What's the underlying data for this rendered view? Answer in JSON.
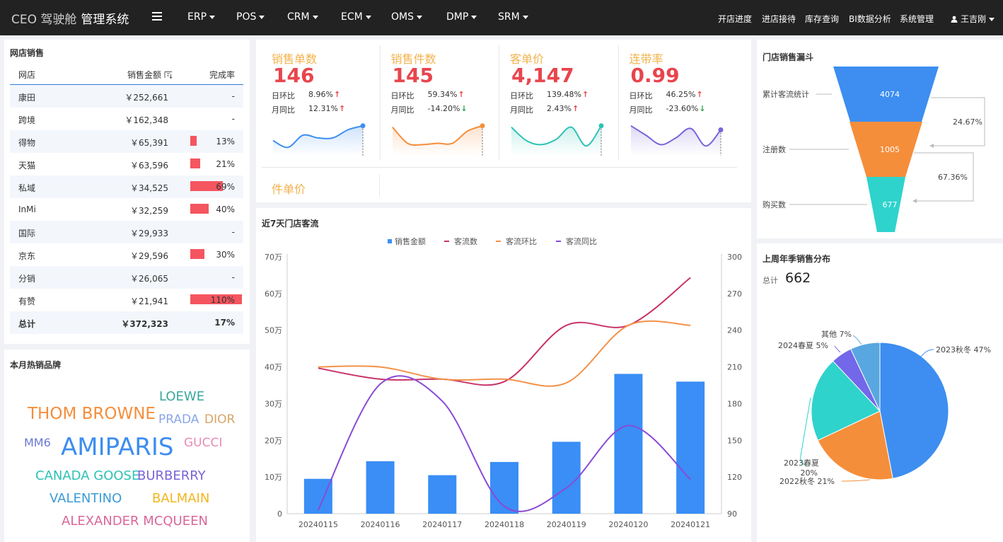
{
  "nav": {
    "brand_prefix": "CEO 驾驶舱",
    "brand_suffix": "管理系统",
    "menus": [
      "ERP",
      "POS",
      "CRM",
      "ECM",
      "OMS",
      "DMP",
      "SRM"
    ],
    "links": [
      "开店进度",
      "进店接待",
      "库存查询",
      "BI数据分析",
      "系统管理"
    ],
    "user": "王吉刚"
  },
  "store_sales": {
    "title": "网店销售",
    "columns": [
      "网店",
      "销售金额",
      "完成率"
    ],
    "rows": [
      {
        "name": "康田",
        "amount": "￥252,661",
        "rate": "-",
        "pct": null
      },
      {
        "name": "跨境",
        "amount": "￥162,348",
        "rate": "-",
        "pct": null
      },
      {
        "name": "得物",
        "amount": "￥65,391",
        "rate": "13%",
        "pct": 0.13
      },
      {
        "name": "天猫",
        "amount": "￥63,596",
        "rate": "21%",
        "pct": 0.21
      },
      {
        "name": "私域",
        "amount": "￥34,525",
        "rate": "69%",
        "pct": 0.69
      },
      {
        "name": "InMi",
        "amount": "￥32,259",
        "rate": "40%",
        "pct": 0.4
      },
      {
        "name": "国际",
        "amount": "￥29,933",
        "rate": "-",
        "pct": null
      },
      {
        "name": "京东",
        "amount": "￥29,596",
        "rate": "30%",
        "pct": 0.3
      },
      {
        "name": "分销",
        "amount": "￥26,065",
        "rate": "-",
        "pct": null
      },
      {
        "name": "有赞",
        "amount": "￥21,941",
        "rate": "110%",
        "pct": 1.1
      }
    ],
    "total": {
      "name": "总计",
      "amount": "￥372,323",
      "rate": "17%"
    }
  },
  "hot_brands": {
    "title": "本月热销品牌",
    "words": [
      {
        "text": "LOEWE",
        "color": "#3aa79a"
      },
      {
        "text": "THOM BROWNE",
        "color": "#f58e3b"
      },
      {
        "text": "PRADA",
        "color": "#8aa6e8"
      },
      {
        "text": "DIOR",
        "color": "#d8a465"
      },
      {
        "text": "MM6",
        "color": "#6b78d6"
      },
      {
        "text": "AMIPARIS",
        "color": "#3d8ef0"
      },
      {
        "text": "GUCCI",
        "color": "#e68cb4"
      },
      {
        "text": "CANADA GOOSE",
        "color": "#2ec2b6"
      },
      {
        "text": "BURBERRY",
        "color": "#7b63d9"
      },
      {
        "text": "VALENTINO",
        "color": "#3b9bd6"
      },
      {
        "text": "BALMAIN",
        "color": "#f2b51e"
      },
      {
        "text": "ALEXANDER MCQUEEN",
        "color": "#d9679a"
      }
    ]
  },
  "kpis": [
    {
      "label": "销售单数",
      "value": "146",
      "dod_label": "日环比",
      "dod": "8.96%",
      "dod_dir": "up",
      "mom_label": "月同比",
      "mom": "12.31%",
      "mom_dir": "up",
      "color": "#3d8ef0",
      "spark": [
        0.35,
        0.1,
        0.55,
        0.45,
        0.45,
        0.75,
        0.9
      ]
    },
    {
      "label": "销售件数",
      "value": "145",
      "dod_label": "日环比",
      "dod": "59.34%",
      "dod_dir": "up",
      "mom_label": "月同比",
      "mom": "-14.20%",
      "mom_dir": "down",
      "color": "#f58e3b",
      "spark": [
        0.85,
        0.25,
        0.2,
        0.25,
        0.25,
        0.7,
        0.9
      ]
    },
    {
      "label": "客单价",
      "value": "4,147",
      "dod_label": "日环比",
      "dod": "139.48%",
      "dod_dir": "up",
      "mom_label": "月同比",
      "mom": "2.43%",
      "mom_dir": "up",
      "color": "#2ec2b6",
      "spark": [
        0.85,
        0.35,
        0.2,
        0.4,
        0.85,
        0.15,
        0.9
      ]
    },
    {
      "label": "连带率",
      "value": "0.99",
      "dod_label": "日环比",
      "dod": "46.25%",
      "dod_dir": "up",
      "mom_label": "月同比",
      "mom": "-23.60%",
      "mom_dir": "down",
      "color": "#7b63d9",
      "spark": [
        0.9,
        0.55,
        0.2,
        0.45,
        0.8,
        0.15,
        0.75
      ]
    }
  ],
  "kpi_extra": {
    "label": "件单价"
  },
  "traffic": {
    "title": "近7天门店客流",
    "legend": [
      "销售金额",
      "客流数",
      "客流环比",
      "客流同比"
    ],
    "colors": {
      "bar": "#3a8ef6",
      "flow": "#c8326a",
      "mom": "#f29249",
      "yoy": "#8a4ad6"
    },
    "left_ticks": [
      "0",
      "10万",
      "20万",
      "30万",
      "40万",
      "50万",
      "60万",
      "70万"
    ],
    "right_ticks": [
      "90",
      "120",
      "150",
      "180",
      "210",
      "240",
      "270",
      "300"
    ]
  },
  "chart_data": {
    "type": "bar",
    "categories": [
      "20240115",
      "20240116",
      "20240117",
      "20240118",
      "20240119",
      "20240120",
      "20240121"
    ],
    "ylim_left": [
      0,
      700000
    ],
    "ylim_right": [
      90,
      300
    ],
    "series": [
      {
        "name": "销售金额",
        "type": "bar",
        "axis": "left",
        "values": [
          95000,
          143000,
          105000,
          141000,
          196000,
          381000,
          360000
        ]
      },
      {
        "name": "客流数",
        "type": "line",
        "axis": "right",
        "values": [
          209,
          200,
          200,
          198,
          244,
          244,
          283
        ]
      },
      {
        "name": "客流环比",
        "type": "line",
        "axis": "right",
        "values": [
          210,
          210,
          200,
          200,
          197,
          244,
          244
        ]
      },
      {
        "name": "客流同比",
        "type": "line",
        "axis": "right",
        "values": [
          93,
          196,
          182,
          96,
          111,
          162,
          118
        ]
      }
    ]
  },
  "funnel": {
    "title": "门店销售漏斗",
    "stages": [
      {
        "label": "累计客流统计",
        "value": "4074",
        "color": "#3d8ef0"
      },
      {
        "label": "注册数",
        "value": "1005",
        "color": "#f58e3b"
      },
      {
        "label": "购买数",
        "value": "677",
        "color": "#2ed3cc"
      }
    ],
    "rates": [
      "24.67%",
      "67.36%"
    ]
  },
  "season": {
    "title": "上周年季销售分布",
    "total_label": "总计",
    "total": "662",
    "slices": [
      {
        "name": "2023秋冬",
        "pct": 47,
        "label": "2023秋冬 47%",
        "color": "#3d8ef0"
      },
      {
        "name": "2022秋冬",
        "pct": 21,
        "label": "2022秋冬 21%",
        "color": "#f58e3b"
      },
      {
        "name": "2023春夏",
        "pct": 20,
        "label1": "2023春夏",
        "label2": "20%",
        "color": "#2ed3cc"
      },
      {
        "name": "2024春夏",
        "pct": 5,
        "label": "2024春夏 5%",
        "color": "#7367ea"
      },
      {
        "name": "其他",
        "pct": 7,
        "label": "其他 7%",
        "color": "#58a7e0"
      }
    ]
  }
}
